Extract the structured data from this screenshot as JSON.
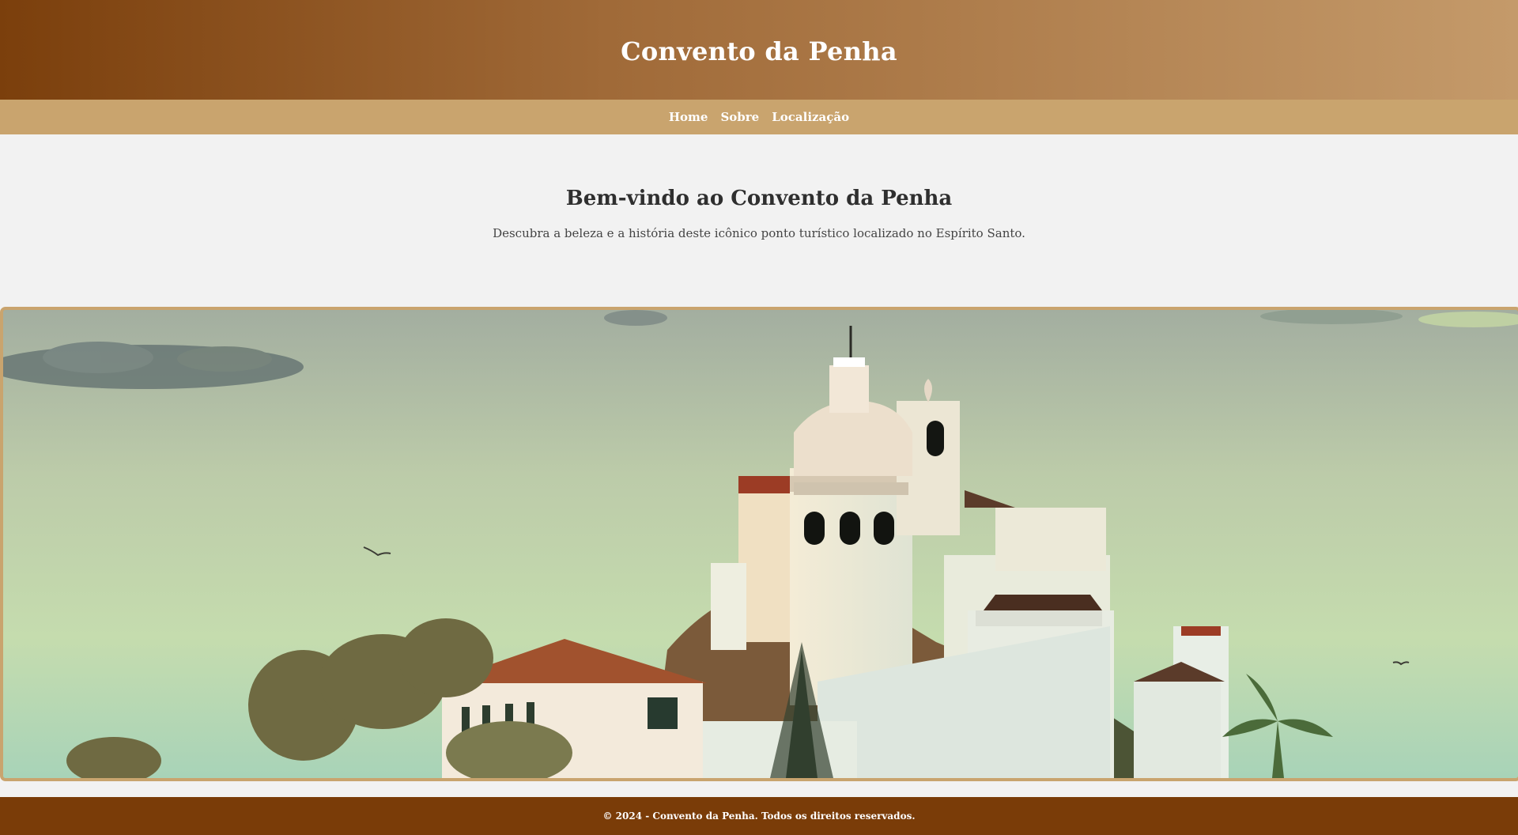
{
  "header": {
    "title": "Convento da Penha"
  },
  "nav": {
    "items": [
      {
        "label": "Home"
      },
      {
        "label": "Sobre"
      },
      {
        "label": "Localização"
      }
    ]
  },
  "intro": {
    "title": "Bem-vindo ao Convento da Penha",
    "text": "Descubra a beleza e a história deste icônico ponto turístico localizado no Espírito Santo."
  },
  "hero": {
    "image_subject": "convent-on-hill-photo"
  },
  "footer": {
    "text": "© 2024 - Convento da Penha. Todos os direitos reservados."
  },
  "colors": {
    "header_gradient_start": "#7b3f0c",
    "header_gradient_end": "#c49a6a",
    "nav_bg": "#c9a46e",
    "page_bg": "#f2f2f2",
    "footer_bg": "#7a3c08",
    "image_border": "#c9a46e"
  }
}
